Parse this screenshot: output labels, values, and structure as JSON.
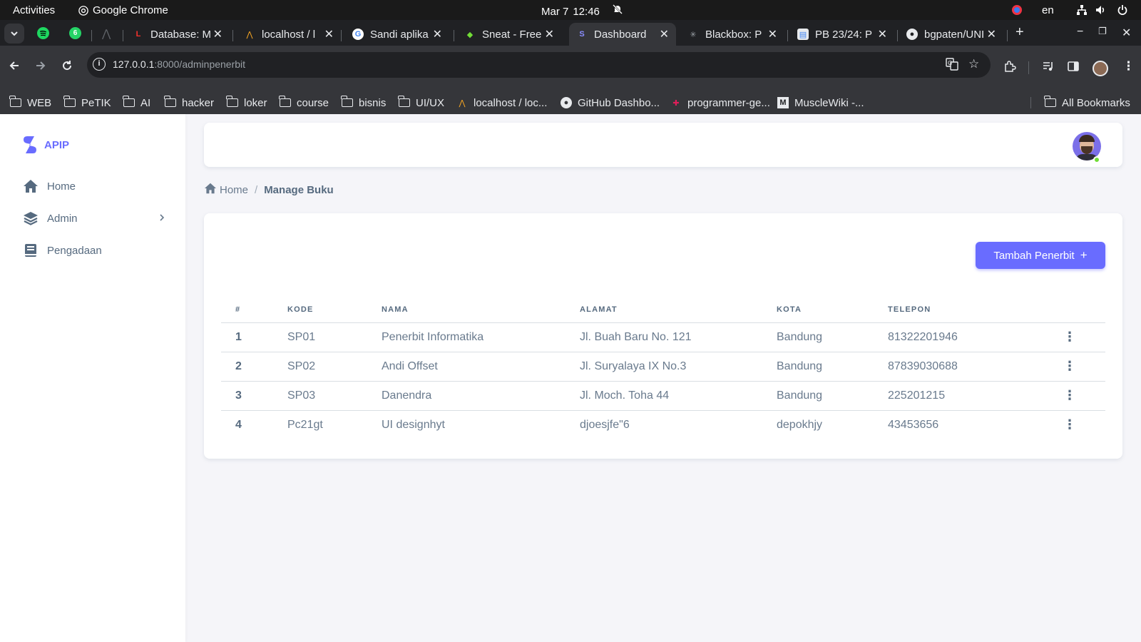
{
  "system_bar": {
    "activities": "Activities",
    "app_name": "Google Chrome",
    "date": "Mar 7",
    "time": "12:46",
    "language": "en"
  },
  "tabs": [
    {
      "title": "Database: M",
      "favicon": "laravel-icon",
      "active": false
    },
    {
      "title": "localhost / l",
      "favicon": "phpmyadmin-icon",
      "active": false
    },
    {
      "title": "Sandi aplika",
      "favicon": "google-icon",
      "active": false
    },
    {
      "title": "Sneat - Free",
      "favicon": "sneat-icon",
      "active": false
    },
    {
      "title": "Dashboard",
      "favicon": "sneat-logo-icon",
      "active": true
    },
    {
      "title": "Blackbox: P",
      "favicon": "blackbox-icon",
      "active": false
    },
    {
      "title": "PB 23/24: P",
      "favicon": "docs-icon",
      "active": false
    },
    {
      "title": "bgpaten/UNI",
      "favicon": "github-icon",
      "active": false
    }
  ],
  "pinned_tab_badge": "6",
  "address": {
    "host": "127.0.0.1",
    "path": ":8000/adminpenerbit"
  },
  "bookmarks": [
    {
      "label": "WEB",
      "type": "folder"
    },
    {
      "label": "PeTIK",
      "type": "folder"
    },
    {
      "label": "AI",
      "type": "folder"
    },
    {
      "label": "hacker",
      "type": "folder"
    },
    {
      "label": "loker",
      "type": "folder"
    },
    {
      "label": "course",
      "type": "folder"
    },
    {
      "label": "bisnis",
      "type": "folder"
    },
    {
      "label": "UI/UX",
      "type": "folder"
    },
    {
      "label": "localhost / loc...",
      "type": "site"
    },
    {
      "label": "GitHub Dashbo...",
      "type": "site"
    },
    {
      "label": "programmer-ge...",
      "type": "site"
    },
    {
      "label": "MuscleWiki -...",
      "type": "site"
    },
    {
      "label": "All Bookmarks",
      "type": "folder"
    }
  ],
  "sidebar": {
    "brand": "APIP",
    "items": [
      {
        "label": "Home",
        "icon": "home-icon"
      },
      {
        "label": "Admin",
        "icon": "layers-icon"
      },
      {
        "label": "Pengadaan",
        "icon": "book-icon"
      }
    ]
  },
  "breadcrumb": {
    "home": "Home",
    "separator": "/",
    "current": "Manage Buku"
  },
  "main": {
    "add_button": "Tambah Penerbit",
    "table": {
      "headers": [
        "#",
        "KODE",
        "NAMA",
        "ALAMAT",
        "KOTA",
        "TELEPON"
      ],
      "rows": [
        [
          "1",
          "SP01",
          "Penerbit Informatika",
          "Jl. Buah Baru No. 121",
          "Bandung",
          "81322201946"
        ],
        [
          "2",
          "SP02",
          "Andi Offset",
          "Jl. Suryalaya IX No.3",
          "Bandung",
          "87839030688"
        ],
        [
          "3",
          "SP03",
          "Danendra",
          "Jl. Moch. Toha 44",
          "Bandung",
          "225201215"
        ],
        [
          "4",
          "Pc21gt",
          "UI designhyt",
          "djoesjfe\"6",
          "depokhjy",
          "43453656"
        ]
      ]
    }
  },
  "colors": {
    "primary": "#696cff",
    "text": "#697a8d",
    "heading": "#566a7f",
    "background": "#f5f5f9",
    "online": "#71dd37"
  }
}
